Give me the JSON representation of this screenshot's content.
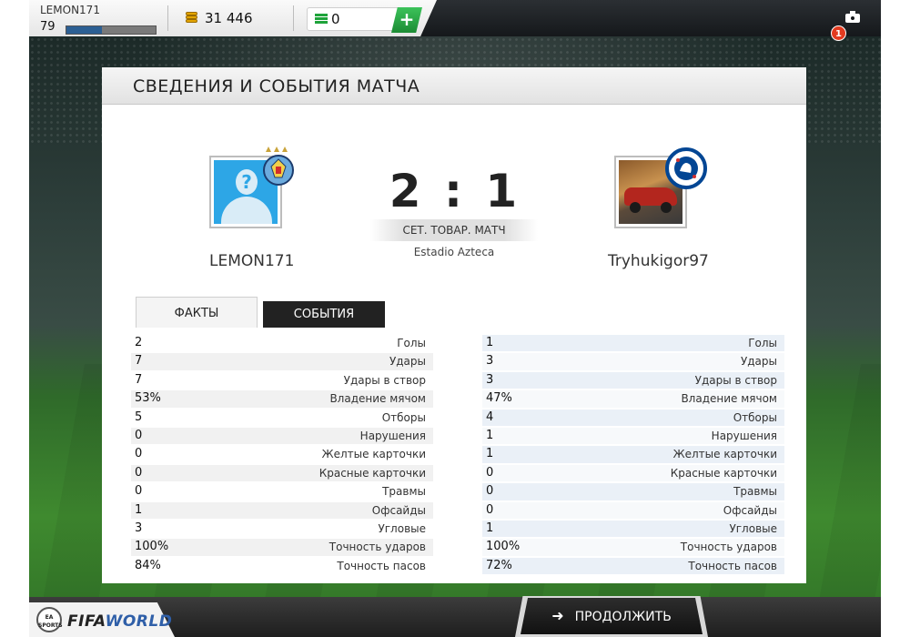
{
  "topbar": {
    "username": "LEMON171",
    "level": "79",
    "xp_fraction": 0.4,
    "coins": "31 446",
    "cash": "0",
    "add_label": "+",
    "notifications": "1"
  },
  "panel": {
    "title": "СВЕДЕНИЯ И СОБЫТИЯ МАТЧА"
  },
  "match": {
    "home_name": "LEMON171",
    "away_name": "Tryhukigor97",
    "score": "2 : 1",
    "match_type": "СЕТ. ТОВАР. МАТЧ",
    "stadium": "Estadio Azteca"
  },
  "tabs": {
    "facts": "ФАКТЫ",
    "events": "СОБЫТИЯ"
  },
  "stats": [
    {
      "label": "Голы",
      "home": "2",
      "away": "1"
    },
    {
      "label": "Удары",
      "home": "7",
      "away": "3"
    },
    {
      "label": "Удары в створ",
      "home": "7",
      "away": "3"
    },
    {
      "label": "Владение мячом",
      "home": "53%",
      "away": "47%"
    },
    {
      "label": "Отборы",
      "home": "5",
      "away": "4"
    },
    {
      "label": "Нарушения",
      "home": "0",
      "away": "1"
    },
    {
      "label": "Желтые карточки",
      "home": "0",
      "away": "1"
    },
    {
      "label": "Красные карточки",
      "home": "0",
      "away": "0"
    },
    {
      "label": "Травмы",
      "home": "0",
      "away": "0"
    },
    {
      "label": "Офсайды",
      "home": "1",
      "away": "0"
    },
    {
      "label": "Угловые",
      "home": "3",
      "away": "1"
    },
    {
      "label": "Точность ударов",
      "home": "100%",
      "away": "100%"
    },
    {
      "label": "Точность пасов",
      "home": "84%",
      "away": "72%"
    }
  ],
  "footer": {
    "ea_label": "EA SPORTS",
    "logo_fifa": "FIFA",
    "logo_world": "WORLD",
    "continue_label": "ПРОДОЛЖИТЬ"
  },
  "colors": {
    "accent_blue": "#2da6e6",
    "cash_green": "#1ea33a",
    "notification_red": "#e23a1f"
  },
  "icons": [
    "coins-icon",
    "cash-icon",
    "camera-icon",
    "arrow-right-icon",
    "man-city-crest-icon",
    "chelsea-crest-icon",
    "default-avatar-icon"
  ]
}
